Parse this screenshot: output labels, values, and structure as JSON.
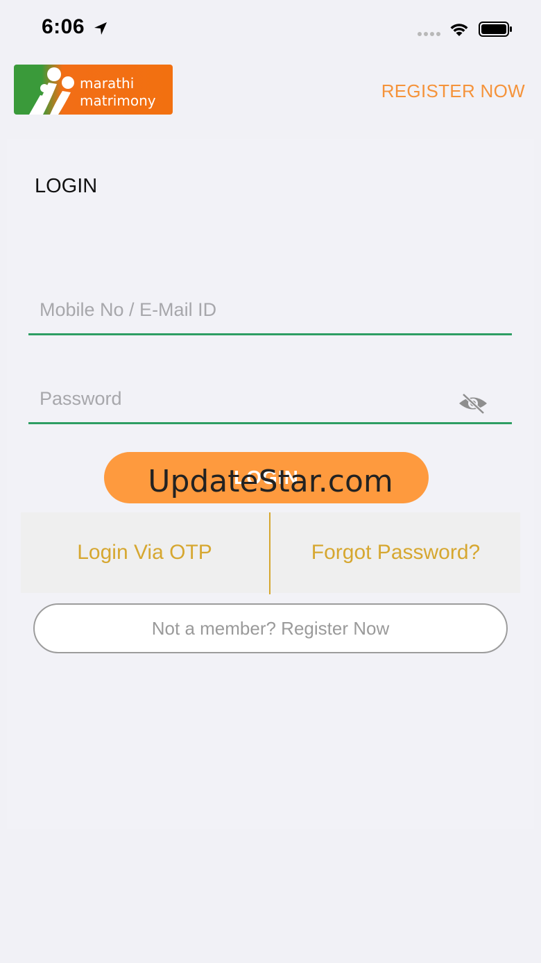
{
  "status_bar": {
    "time": "6:06",
    "icons": [
      "location-arrow-icon",
      "cellular-signal-icon",
      "wifi-icon",
      "battery-icon"
    ]
  },
  "header": {
    "logo_line1": "marathi",
    "logo_line2": "matrimony",
    "register_label": "REGISTER NOW"
  },
  "login": {
    "title": "LOGIN",
    "mobile_placeholder": "Mobile No / E-Mail ID",
    "password_placeholder": "Password",
    "button_label": "LOGIN",
    "otp_label": "Login Via OTP",
    "forgot_label": "Forgot Password?",
    "member_label": "Not a member? Register Now"
  },
  "watermark": "UpdateStar.com",
  "colors": {
    "accent_orange": "#fe9a3e",
    "register_orange": "#f5933a",
    "field_underline_green": "#2e9e63",
    "link_gold": "#d6a730",
    "logo_green": "#3a9a3a",
    "logo_orange": "#f26e16"
  }
}
